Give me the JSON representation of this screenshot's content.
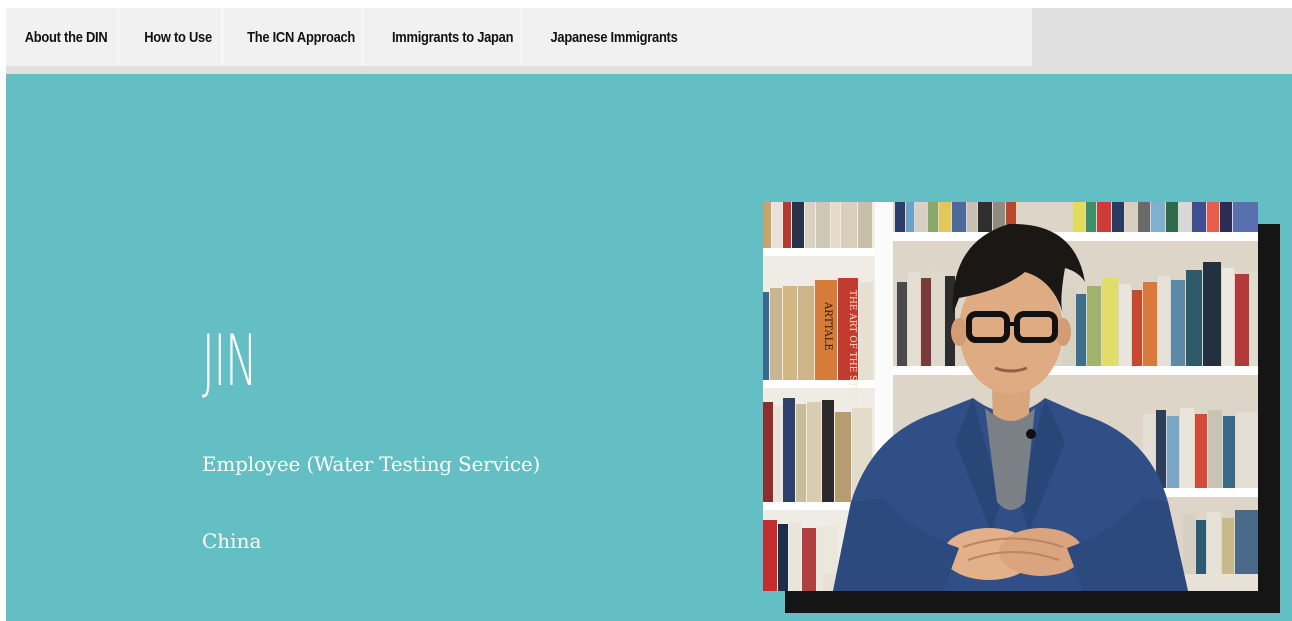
{
  "nav": {
    "items": [
      {
        "label": "About the DIN"
      },
      {
        "label": "How to Use"
      },
      {
        "label": "The ICN Approach"
      },
      {
        "label": "Immigrants to Japan"
      },
      {
        "label": "Japanese Immigrants"
      }
    ]
  },
  "profile": {
    "name": "JIN",
    "occupation": "Employee (Water Testing Service)",
    "country": "China"
  },
  "colors": {
    "hero_background": "#63bfc3",
    "nav_background": "#f1f1f1"
  },
  "photo": {
    "spine_texts": [
      "THE ART OF THE STORY",
      "ARTTALE"
    ]
  }
}
